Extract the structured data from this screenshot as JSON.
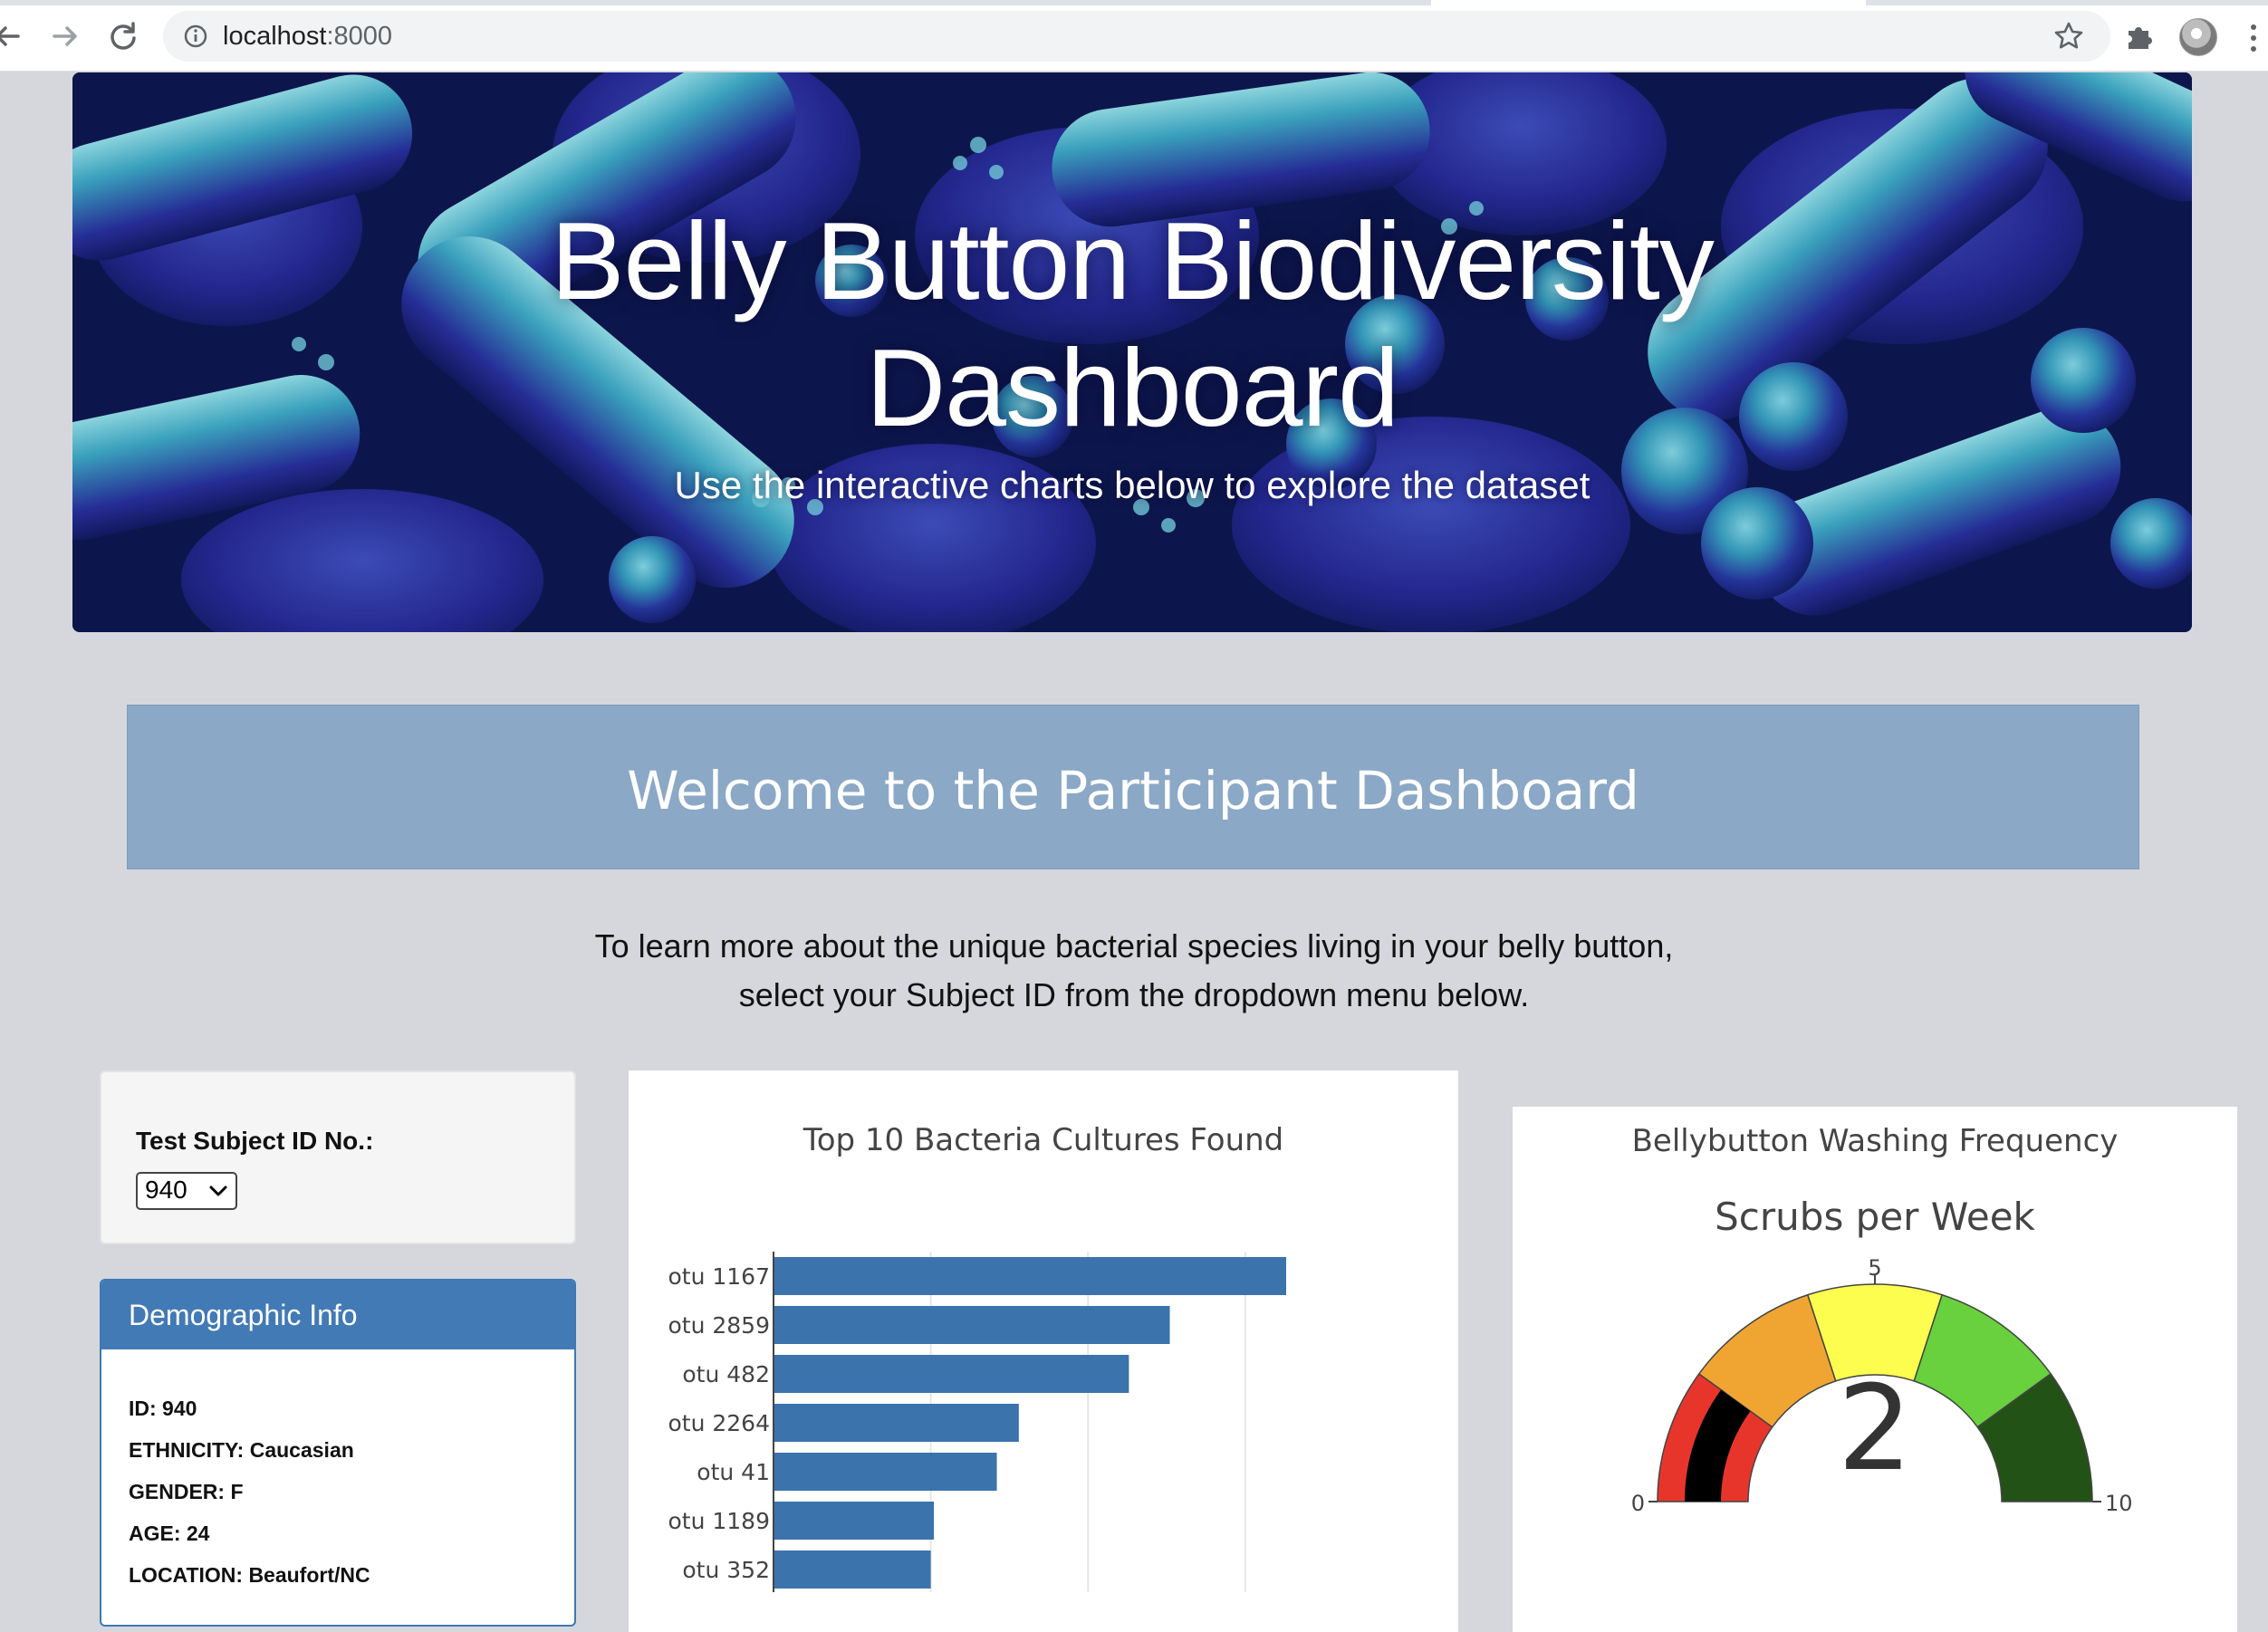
{
  "browser": {
    "url_host": "localhost",
    "url_port": ":8000"
  },
  "hero": {
    "title_line1": "Belly Button Biodiversity",
    "title_line2": "Dashboard",
    "subtitle": "Use the interactive charts below to explore the dataset"
  },
  "welcome": {
    "heading": "Welcome to the Participant Dashboard"
  },
  "intro": {
    "line1": "To learn more about the unique bacterial species living in your belly button,",
    "line2": "select your Subject ID from the dropdown menu below."
  },
  "selector": {
    "label": "Test Subject ID No.:",
    "selected": "940"
  },
  "demographics": {
    "title": "Demographic Info",
    "rows": [
      "ID: 940",
      "ETHNICITY: Caucasian",
      "GENDER: F",
      "AGE: 24",
      "LOCATION: Beaufort/NC"
    ]
  },
  "chart_data": [
    {
      "type": "bar",
      "orientation": "horizontal",
      "title": "Top 10 Bacteria Cultures Found",
      "categories": [
        "otu 1167",
        "otu 2859",
        "otu 482",
        "otu 2264",
        "otu 41",
        "otu 1189",
        "otu 352"
      ],
      "values": [
        163,
        126,
        113,
        78,
        71,
        51,
        50
      ],
      "xlim": [
        0,
        170
      ],
      "grid": true,
      "color": "#3b73ad"
    },
    {
      "type": "gauge",
      "title": "Bellybutton Washing Frequency",
      "subtitle": "Scrubs per Week",
      "value": 2,
      "range": [
        0,
        10
      ],
      "tick_labels": [
        "0",
        "5",
        "10"
      ],
      "bands": [
        {
          "from": 0,
          "to": 2,
          "color": "#e8352b"
        },
        {
          "from": 2,
          "to": 4,
          "color": "#f0a533"
        },
        {
          "from": 4,
          "to": 6,
          "color": "#fdfd4f"
        },
        {
          "from": 6,
          "to": 8,
          "color": "#68d13d"
        },
        {
          "from": 8,
          "to": 10,
          "color": "#235217"
        }
      ],
      "bar_color": "#000000"
    }
  ]
}
